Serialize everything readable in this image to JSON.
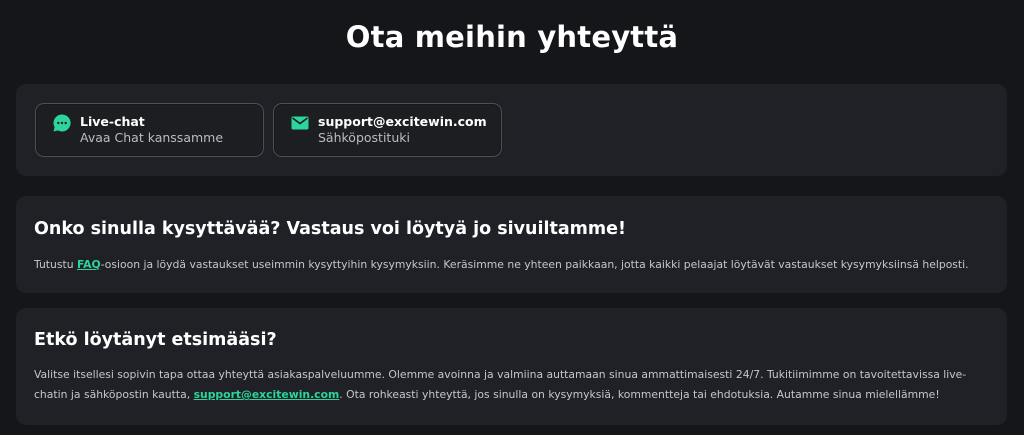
{
  "page": {
    "title": "Ota meihin yhteyttä"
  },
  "contact": {
    "chat": {
      "icon": "chat-bubble-icon",
      "title": "Live-chat",
      "subtitle": "Avaa Chat kanssamme"
    },
    "email": {
      "icon": "envelope-icon",
      "title": "support@excitewin.com",
      "subtitle": "Sähköpostituki"
    }
  },
  "faq": {
    "heading": "Onko sinulla kysyttävää? Vastaus voi löytyä jo sivuiltamme!",
    "text_before": "Tutustu ",
    "link": "FAQ",
    "text_after": "-osioon ja löydä vastaukset useimmin kysyttyihin kysymyksiin. Keräsimme ne yhteen paikkaan, jotta kaikki pelaajat löytävät vastaukset kysymyksiinsä helposti."
  },
  "help": {
    "heading": "Etkö löytänyt etsimääsi?",
    "text_before": "Valitse itsellesi sopivin tapa ottaa yhteyttä asiakaspalveluumme. Olemme avoinna ja valmiina auttamaan sinua ammattimaisesti 24/7. Tukitiimimme on tavoitettavissa live-chatin ja sähköpostin kautta, ",
    "link": "support@excitewin.com",
    "text_after": ". Ota rohkeasti yhteyttä, jos sinulla on kysymyksiä, kommentteja tai ehdotuksia. Autamme sinua mielellämme!"
  },
  "colors": {
    "accent": "#2bd59b",
    "background": "#151619",
    "panel": "#1f2126"
  }
}
